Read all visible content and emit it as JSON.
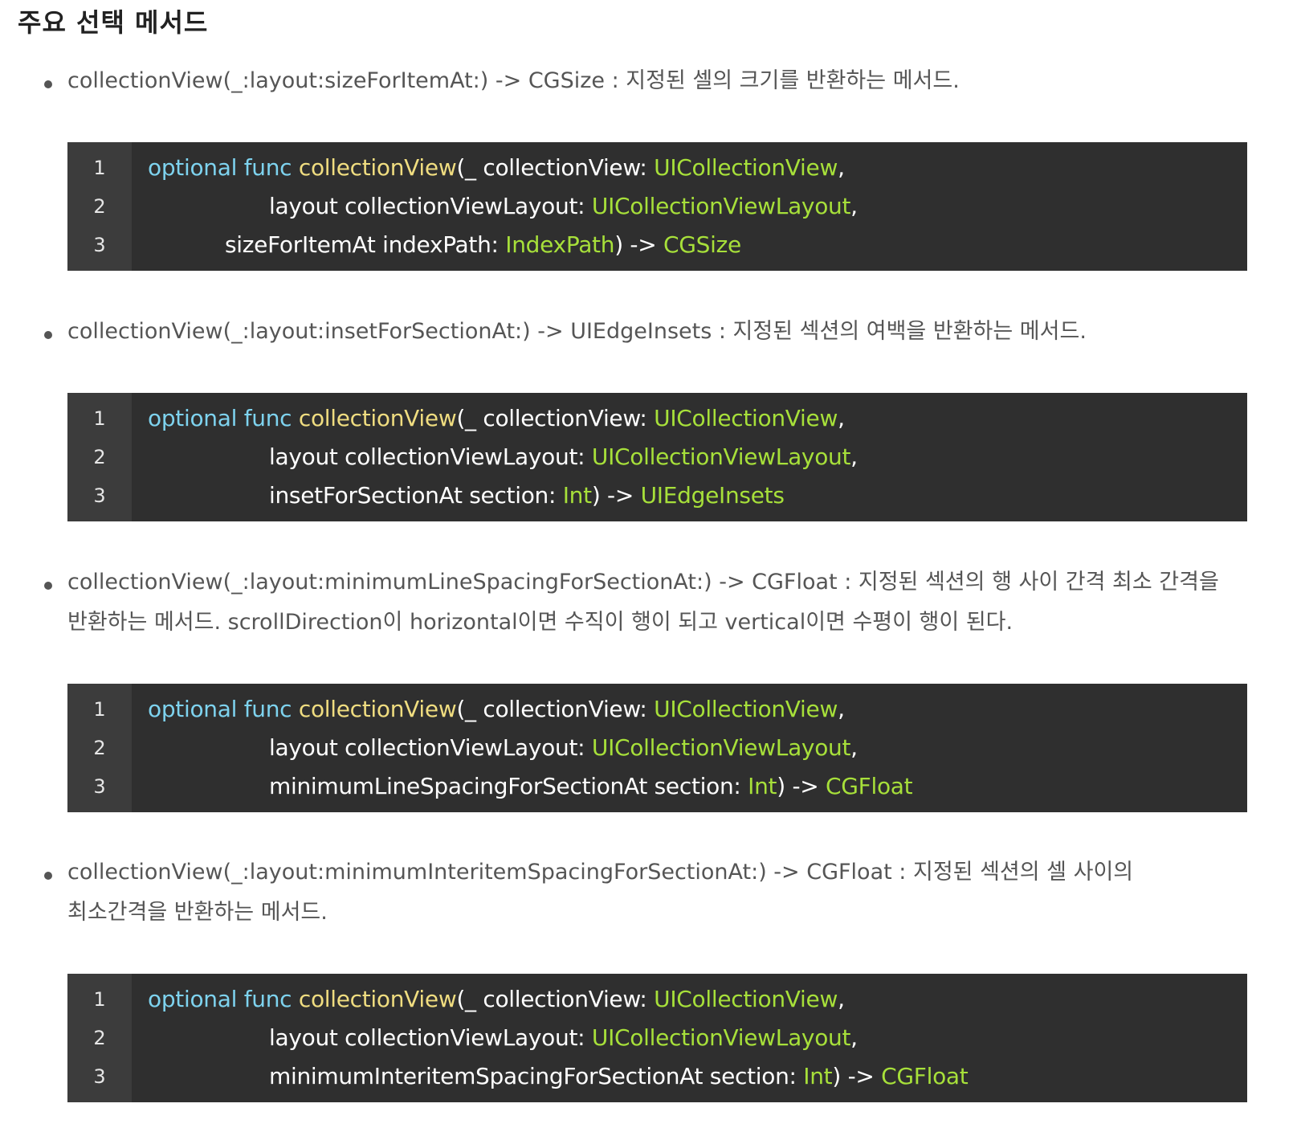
{
  "page": {
    "title": "주요 선택 메서드"
  },
  "colors": {
    "keyword": "#7ed3ef",
    "function_name": "#f0dd80",
    "type": "#a7e03a",
    "code_background": "#2f2f2f",
    "gutter_background": "#3c3c3c"
  },
  "code": {
    "line_numbers": [
      "1",
      "2",
      "3"
    ],
    "kw_optional": "optional",
    "kw_func": "func",
    "fn_name": "collectionView",
    "param_first": "(_ collectionView: ",
    "type_collection_view": "UICollectionView",
    "comma": ",",
    "param_layout": "layout collectionViewLayout: ",
    "type_layout": "UICollectionViewLayout",
    "arrow": ") -> "
  },
  "sections": [
    {
      "text": "collectionView(_:layout:sizeForItemAt:) -> CGSize : 지정된 셀의 크기를 반환하는 메서드.",
      "line3_param": "sizeForItemAt indexPath: ",
      "line3_type": "IndexPath",
      "line3_return": "CGSize"
    },
    {
      "text": "collectionView(_:layout:insetForSectionAt:) -> UIEdgeInsets : 지정된 섹션의 여백을 반환하는 메서드.",
      "line3_param": "insetForSectionAt section: ",
      "line3_type": "Int",
      "line3_return": "UIEdgeInsets"
    },
    {
      "text": "collectionView(_:layout:minimumLineSpacingForSectionAt:) -> CGFloat : 지정된 섹션의 행 사이 간격 최소 간격을 반환하는 메서드. scrollDirection이 horizontal이면 수직이 행이 되고 vertical이면 수평이 행이 된다.",
      "line3_param": "minimumLineSpacingForSectionAt section: ",
      "line3_type": "Int",
      "line3_return": "CGFloat"
    },
    {
      "text": "collectionView(_:layout:minimumInteritemSpacingForSectionAt:) -> CGFloat : 지정된 섹션의 셀 사이의 최소간격을 반환하는 메서드.",
      "line3_param": "minimumInteritemSpacingForSectionAt section: ",
      "line3_type": "Int",
      "line3_return": "CGFloat"
    }
  ]
}
